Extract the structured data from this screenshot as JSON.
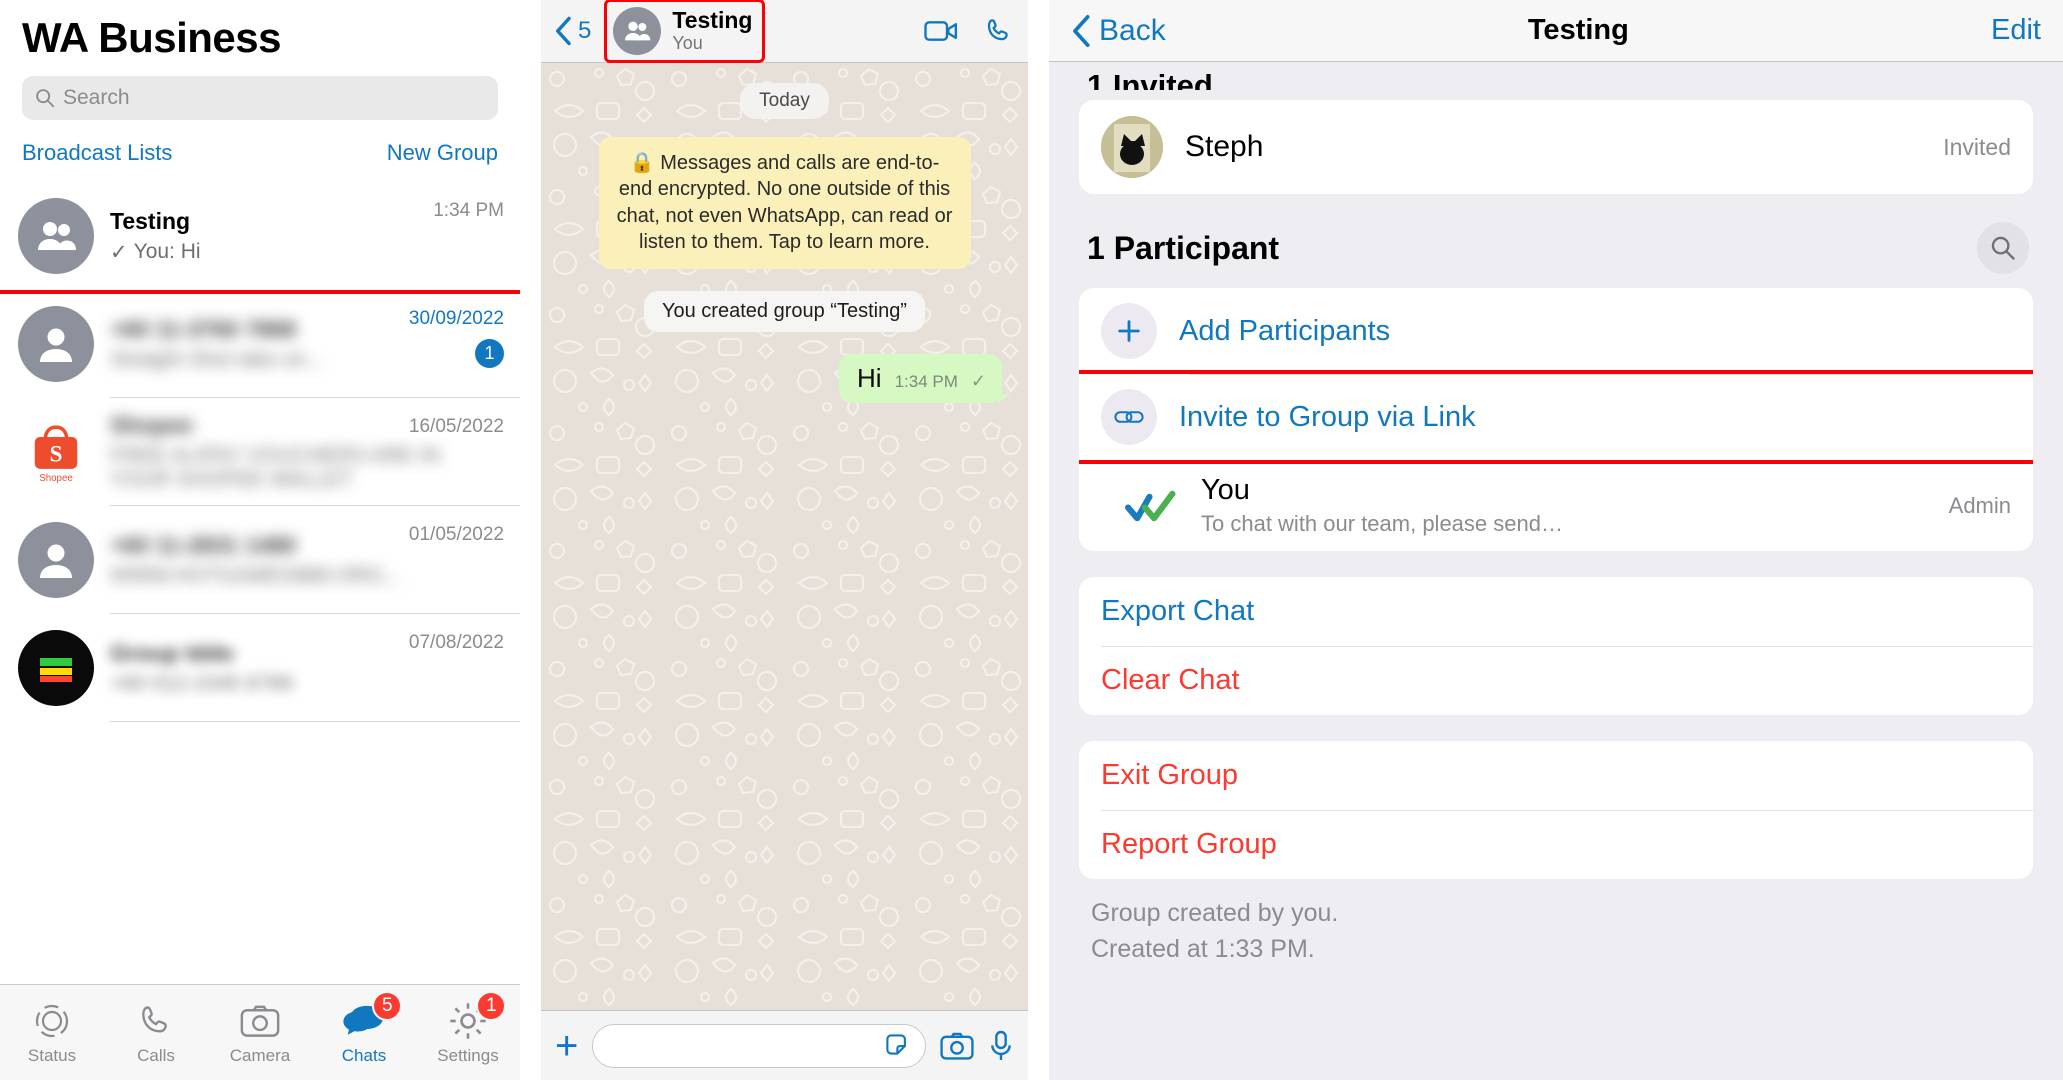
{
  "chat_list": {
    "title": "WA Business",
    "search": {
      "placeholder": "Search",
      "value": ""
    },
    "links": {
      "broadcast": "Broadcast Lists",
      "new_group": "New Group"
    },
    "rows": [
      {
        "name": "Testing",
        "preview": "You: Hi",
        "tick": "✓",
        "time": "1:34 PM",
        "avatar": "group-icon",
        "highlighted": true,
        "blurred": false,
        "unread": ""
      },
      {
        "name": "+60 11-3760 7868",
        "preview": "Straight Shot take on...",
        "tick": "",
        "time": "30/09/2022",
        "avatar": "person-icon",
        "highlighted": false,
        "blurred": true,
        "unread": "1"
      },
      {
        "name": "Shopee",
        "preview": "FREE ALIPAY VOUCHERS ARE IN YOUR SHOPEE WALLET",
        "tick": "",
        "time": "16/05/2022",
        "avatar": "shopee-icon",
        "highlighted": false,
        "blurred": true,
        "unread": ""
      },
      {
        "name": "+60 11-2831 1480",
        "preview": "WWW.HOTGAMES888.ORG...",
        "tick": "",
        "time": "01/05/2022",
        "avatar": "person-icon",
        "highlighted": false,
        "blurred": true,
        "unread": ""
      },
      {
        "name": "Group Iddo",
        "preview": "+60 012-2345 6789",
        "tick": "",
        "time": "07/08/2022",
        "avatar": "dark-icon",
        "highlighted": false,
        "blurred": true,
        "unread": ""
      }
    ],
    "tabs": [
      {
        "label": "Status",
        "icon": "status-rings-icon",
        "active": false,
        "badge": ""
      },
      {
        "label": "Calls",
        "icon": "phone-icon",
        "active": false,
        "badge": ""
      },
      {
        "label": "Camera",
        "icon": "camera-icon",
        "active": false,
        "badge": ""
      },
      {
        "label": "Chats",
        "icon": "chats-bubbles-icon",
        "active": true,
        "badge": "5"
      },
      {
        "label": "Settings",
        "icon": "gear-icon",
        "active": false,
        "badge": "1"
      }
    ]
  },
  "chat": {
    "back_label": "5",
    "group_name": "Testing",
    "group_sub": "You",
    "day_divider": "Today",
    "encryption_notice": "🔒 Messages and calls are end-to-end encrypted. No one outside of this chat, not even WhatsApp, can read or listen to them. Tap to learn more.",
    "system_message": "You created group “Testing”",
    "messages": [
      {
        "text": "Hi",
        "time": "1:34 PM",
        "status": "✓",
        "outgoing": true
      }
    ],
    "input_placeholder": "",
    "actions": {
      "video": "video-call-icon",
      "voice": "voice-call-icon",
      "plus": "+",
      "sticker": "sticker-icon",
      "camera": "camera-icon",
      "mic": "mic-icon"
    }
  },
  "group_info": {
    "back": "Back",
    "title": "Testing",
    "edit": "Edit",
    "invited_header": "1 Invited",
    "invited": [
      {
        "name": "Steph",
        "status": "Invited",
        "avatar": "cat-photo-avatar"
      }
    ],
    "participants_header": "1 Participant",
    "search_icon": "search-icon",
    "participant_actions": [
      {
        "label": "Add Participants",
        "icon": "plus-icon",
        "highlighted": false
      },
      {
        "label": "Invite to Group via Link",
        "icon": "link-icon",
        "highlighted": true
      }
    ],
    "participants": [
      {
        "name": "You",
        "sub": "To chat with our team, please send…",
        "role": "Admin",
        "icon": "double-check-icon"
      }
    ],
    "chat_actions": [
      {
        "label": "Export Chat",
        "color": "blue"
      },
      {
        "label": "Clear Chat",
        "color": "red"
      }
    ],
    "group_actions": [
      {
        "label": "Exit Group",
        "color": "red"
      },
      {
        "label": "Report Group",
        "color": "red"
      }
    ],
    "footer_line1": "Group created by you.",
    "footer_line2": "Created at 1:33 PM."
  },
  "colors": {
    "accent_blue": "#1178c0",
    "danger_red": "#fb3b30",
    "highlight_red": "#fb0007",
    "bubble_green": "#d6f8c2",
    "encrypt_yellow": "#fbf0b9"
  }
}
